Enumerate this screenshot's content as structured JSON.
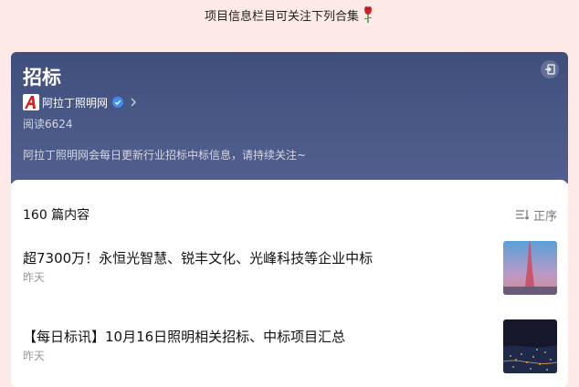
{
  "intro_text": "项目信息栏目可关注下列合集",
  "collection": {
    "title": "招标",
    "author": "阿拉丁照明网",
    "reads": "阅读6624",
    "description": "阿拉丁照明网会每日更新行业招标中标信息，请持续关注~"
  },
  "list": {
    "count_label": "160 篇内容",
    "sort_label": "正序"
  },
  "articles": [
    {
      "title": "超7300万！永恒光智慧、锐丰文化、光峰科技等企业中标",
      "date": "昨天"
    },
    {
      "title": "【每日标讯】10月16日照明相关招标、中标项目汇总",
      "date": "昨天"
    }
  ],
  "colors": {
    "page_bg": "#fde9e8",
    "header_top": "#3f4f7c",
    "header_bottom": "#53608f",
    "verified_blue": "#3e8ef7",
    "logo_red": "#d81e1e"
  }
}
